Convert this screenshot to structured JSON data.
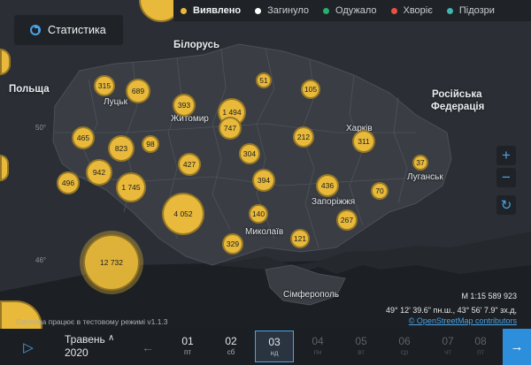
{
  "legend": [
    {
      "label": "Виявлено",
      "color": "#e8b93a",
      "active": true
    },
    {
      "label": "Загинуло",
      "color": "#ffffff",
      "active": false
    },
    {
      "label": "Одужало",
      "color": "#27b06b",
      "active": false
    },
    {
      "label": "Хворіє",
      "color": "#e8523f",
      "active": false
    },
    {
      "label": "Підозри",
      "color": "#3fb6b0",
      "active": false
    }
  ],
  "stats_button": "Статистика",
  "places": {
    "belarus": "Білорусь",
    "poland": "Польща",
    "russia_1": "Російська",
    "russia_2": "Федерація",
    "lutsk": "Луцьк",
    "zhytomyr": "Житомир",
    "kharkiv": "Харків",
    "luhansk": "Луганськ",
    "zaporizhzhia": "Запоріжжя",
    "mykolaiv": "Миколаїв",
    "simferopol": "Сімферополь"
  },
  "latitudes": {
    "l50": "50°",
    "l46": "46°"
  },
  "bubbles": [
    {
      "label": "315"
    },
    {
      "label": "689"
    },
    {
      "label": "393"
    },
    {
      "label": "51"
    },
    {
      "label": "105"
    },
    {
      "label": "1 494"
    },
    {
      "label": "747"
    },
    {
      "label": "465"
    },
    {
      "label": "823"
    },
    {
      "label": "98"
    },
    {
      "label": "212"
    },
    {
      "label": "311"
    },
    {
      "label": "942"
    },
    {
      "label": "427"
    },
    {
      "label": "304"
    },
    {
      "label": "37"
    },
    {
      "label": "496"
    },
    {
      "label": "1 745"
    },
    {
      "label": "394"
    },
    {
      "label": "436"
    },
    {
      "label": "70"
    },
    {
      "label": "4 052"
    },
    {
      "label": "140"
    },
    {
      "label": "267"
    },
    {
      "label": "329"
    },
    {
      "label": "121"
    },
    {
      "label": "12 732"
    }
  ],
  "zoom": {
    "in": "+",
    "out": "−",
    "reset": "↻"
  },
  "scale_text": "M 1:15 589 923",
  "coords_text": "49° 12' 39.6\" пн.ш., 43° 56' 7.9\" зх.д,",
  "attribution": "© OpenStreetMap contributors",
  "test_mode": "Система працює в тестовому режимі v1.1.3",
  "month": "Травень",
  "year": "2020",
  "days": [
    {
      "num": "01",
      "wd": "пт",
      "state": "past"
    },
    {
      "num": "02",
      "wd": "сб",
      "state": "past"
    },
    {
      "num": "03",
      "wd": "нд",
      "state": "selected"
    },
    {
      "num": "04",
      "wd": "пн",
      "state": "future"
    },
    {
      "num": "05",
      "wd": "вт",
      "state": "future"
    },
    {
      "num": "06",
      "wd": "ср",
      "state": "future"
    },
    {
      "num": "07",
      "wd": "чт",
      "state": "future"
    },
    {
      "num": "08",
      "wd": "пт",
      "state": "future"
    }
  ]
}
